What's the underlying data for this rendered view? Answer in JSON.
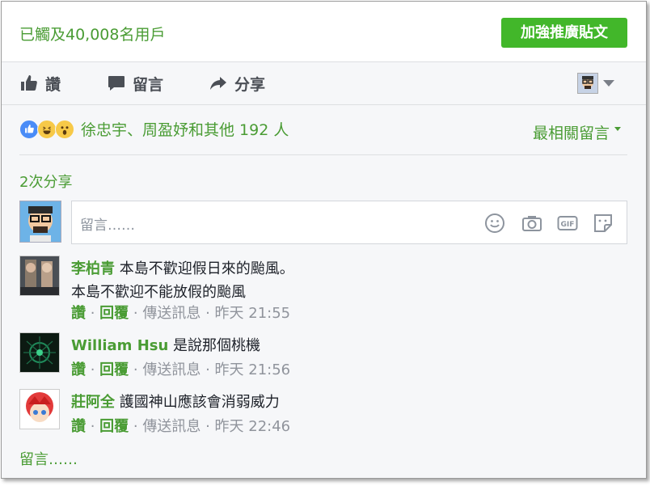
{
  "header": {
    "reach_text": "已觸及40,008名用戶",
    "boost_label": "加強推廣貼文"
  },
  "actions": {
    "like_label": "讚",
    "comment_label": "留言",
    "share_label": "分享"
  },
  "reactions": {
    "icons": [
      "like-reaction",
      "haha-reaction",
      "wow-reaction"
    ],
    "summary": "徐忠宇、周盈妤和其他 192 人"
  },
  "sort": {
    "label": "最相關留言"
  },
  "shares": {
    "count_text": "2次分享"
  },
  "composer": {
    "placeholder": "留言……",
    "icons": [
      "emoji-icon",
      "camera-icon",
      "gif-icon",
      "sticker-icon"
    ]
  },
  "comments": [
    {
      "author": "李柏青",
      "text_line1": "本島不歡迎假日來的颱風。",
      "text_line2": "本島不歡迎不能放假的颱風",
      "like": "讚",
      "reply": "回覆",
      "message": "傳送訊息",
      "time": "昨天 21:55"
    },
    {
      "author": "William Hsu",
      "text_line1": "是說那個桃機",
      "like": "讚",
      "reply": "回覆",
      "message": "傳送訊息",
      "time": "昨天 21:56"
    },
    {
      "author": "莊阿全",
      "text_line1": "護國神山應該會消弱威力",
      "like": "讚",
      "reply": "回覆",
      "message": "傳送訊息",
      "time": "昨天 22:46"
    }
  ],
  "footer": {
    "more_comments": "留言……"
  },
  "colors": {
    "accent_green": "#4a9c34",
    "boost_green": "#42b72a",
    "text_dark": "#1d2129",
    "text_gray": "#90949c"
  }
}
